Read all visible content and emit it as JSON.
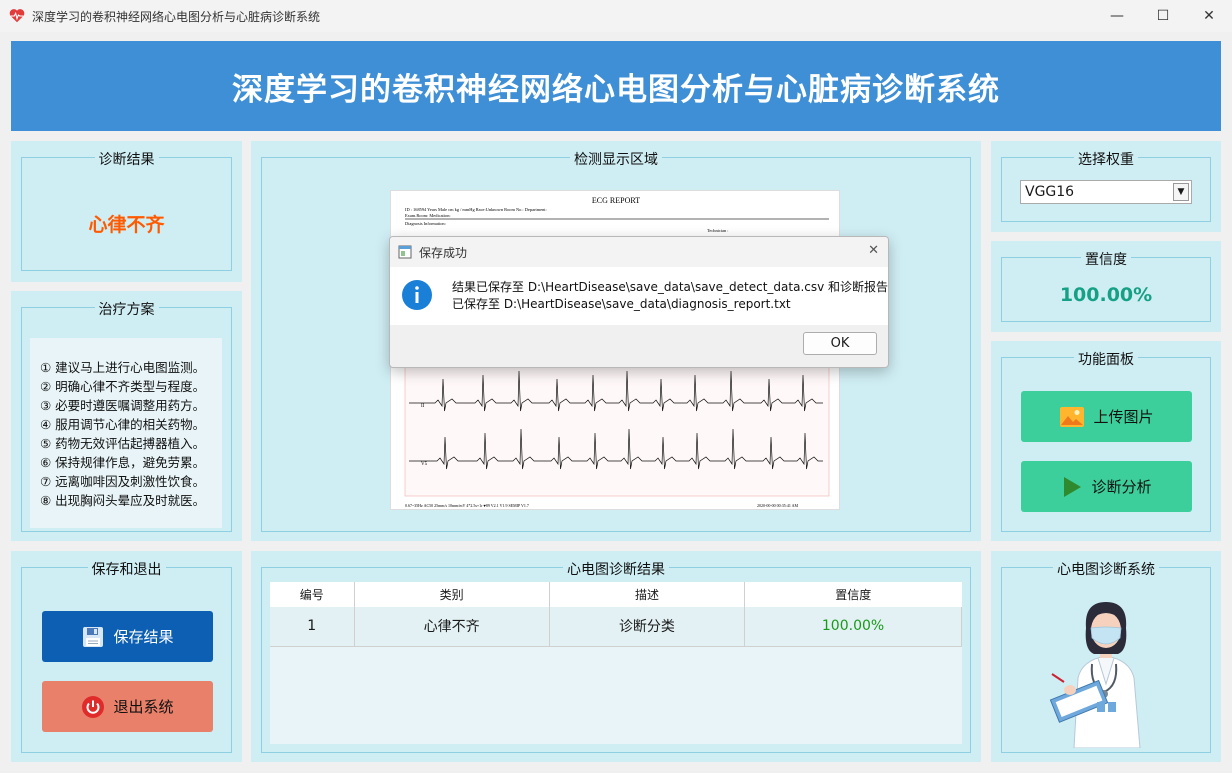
{
  "window": {
    "title": "深度学习的卷积神经网络心电图分析与心脏病诊断系统",
    "minimize": "—",
    "maximize": "☐",
    "close": "✕"
  },
  "header": {
    "title": "深度学习的卷积神经网络心电图分析与心脏病诊断系统"
  },
  "diagnosis": {
    "title": "诊断结果",
    "result": "心律不齐"
  },
  "treatment": {
    "title": "治疗方案",
    "items": [
      "① 建议马上进行心电图监测。",
      "② 明确心律不齐类型与程度。",
      "③ 必要时遵医嘱调整用药方。",
      "④ 服用调节心律的相关药物。",
      "⑤ 药物无效评估起搏器植入。",
      "⑥ 保持规律作息，避免劳累。",
      "⑦ 远离咖啡因及刺激性饮食。",
      "⑧ 出现胸闷头晕应及时就医。"
    ]
  },
  "save_exit": {
    "title": "保存和退出",
    "save_label": "保存结果",
    "exit_label": "退出系统"
  },
  "detection": {
    "title": "检测显示区域",
    "ecg": {
      "report_title": "ECG  REPORT",
      "id_line": "ID : 168594      Years    Male      cm        kg       /     mmHg    Race:Unknown     Room  No.:      Department:",
      "exam_line": "Exam.Room:      Medication:",
      "diag_line": "Diagnosis  Information:",
      "technician": "Technician :",
      "lead_ii": "II",
      "lead_v5": "V5",
      "footer_left": "0.67~35Hz  AC50  25mm/s  10mm/mV  4*2.5s+1r  ♥89   V2.1  V1.9  SEMIP  V1.7",
      "footer_right": "2020-00-00   00:35:41 AM"
    }
  },
  "weights": {
    "title": "选择权重",
    "selected": "VGG16"
  },
  "confidence": {
    "title": "置信度",
    "value": "100.00%"
  },
  "functions": {
    "title": "功能面板",
    "upload_label": "上传图片",
    "diagnose_label": "诊断分析"
  },
  "results_table": {
    "title": "心电图诊断结果",
    "headers": [
      "编号",
      "类别",
      "描述",
      "置信度"
    ],
    "rows": [
      {
        "id": "1",
        "category": "心律不齐",
        "desc": "诊断分类",
        "confidence": "100.00%"
      }
    ]
  },
  "system": {
    "title": "心电图诊断系统"
  },
  "dialog": {
    "title": "保存成功",
    "line1": "结果已保存至 D:\\HeartDisease\\save_data\\save_detect_data.csv 和诊断报告",
    "line2": "已保存至 D:\\HeartDisease\\save_data\\diagnosis_report.txt",
    "ok_label": "OK"
  },
  "colors": {
    "header_blue": "#3e8fd6",
    "panel_bg": "#cfeef4",
    "result_orange": "#ff5a00",
    "confidence_green": "#16a085",
    "button_green": "#3ccf9b",
    "save_blue": "#0d5fb3",
    "exit_salmon": "#e8806a"
  }
}
